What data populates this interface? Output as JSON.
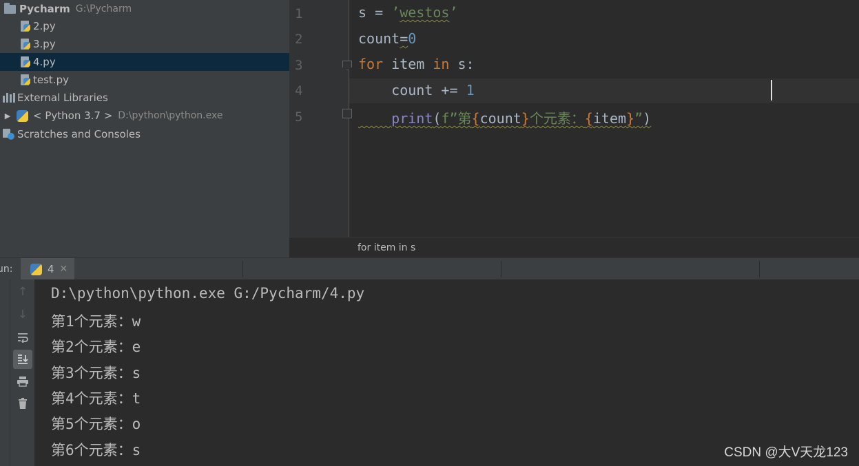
{
  "project": {
    "root_name": "Pycharm",
    "root_path": "G:\\Pycharm",
    "files": [
      "2.py",
      "3.py",
      "4.py",
      "test.py"
    ],
    "selected_file": "4.py",
    "external_libraries": "External Libraries",
    "python_sdk": "< Python 3.7 >",
    "python_path": "D:\\python\\python.exe",
    "scratches": "Scratches and Consoles"
  },
  "editor": {
    "line_numbers": [
      "1",
      "2",
      "3",
      "4",
      "5"
    ],
    "code": {
      "l1_var": "s",
      "l1_eq": " = ",
      "l1_str_q1": "’",
      "l1_str": "westos",
      "l1_str_q2": "’",
      "l2_var": "count",
      "l2_eq": "=",
      "l2_num": "0",
      "l3_for": "for",
      "l3_item": " item ",
      "l3_in": "in",
      "l3_rest": " s:",
      "l4_indent": "    ",
      "l4_var": "count",
      "l4_op": " += ",
      "l4_num": "1",
      "l5_indent": "    ",
      "l5_print": "print",
      "l5_paren": "(",
      "l5_f": "f”第",
      "l5_b1": "{",
      "l5_count": "count",
      "l5_b2": "}",
      "l5_mid": "个元素：",
      "l5_b3": "{",
      "l5_item": "item",
      "l5_b4": "}",
      "l5_end": "”",
      "l5_close": ")"
    },
    "breadcrumb": "for item in s"
  },
  "run": {
    "label": "un:",
    "tab_name": "4",
    "command": "D:\\python\\python.exe G:/Pycharm/4.py",
    "output": [
      "第1个元素：w",
      "第2个元素：e",
      "第3个元素：s",
      "第4个元素：t",
      "第5个元素：o",
      "第6个元素：s"
    ]
  },
  "watermark": "CSDN @大V天龙123"
}
